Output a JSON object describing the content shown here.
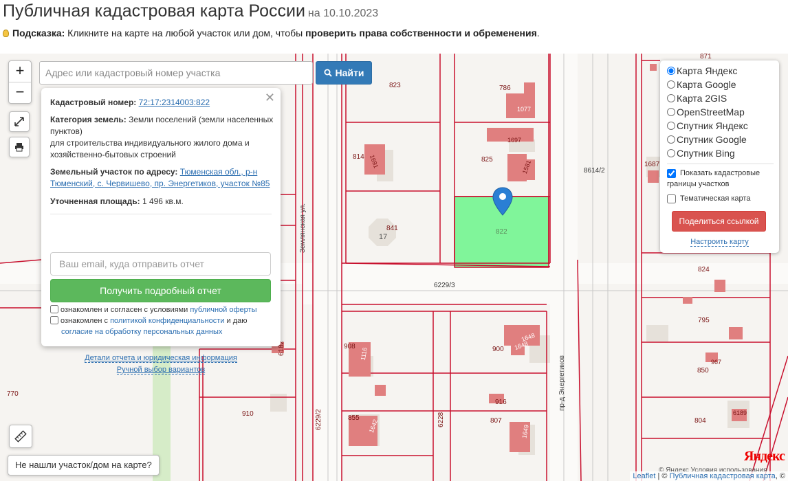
{
  "page": {
    "title": "Публичная кадастровая карта России",
    "date": "на 10.10.2023",
    "hint_label": "Подсказка:",
    "hint_text": " Кликните на карте на любой участок или дом, чтобы ",
    "hint_bold": "проверить права собственности и обременения",
    "hint_end": "."
  },
  "map": {
    "zoom_in": "+",
    "zoom_out": "−",
    "search_placeholder": "Адрес или кадастровый номер участка",
    "search_button": "Найти",
    "not_found": "Не нашли участок/дом на карте?",
    "plot_labels": [
      "871",
      "823",
      "786",
      "814",
      "825",
      "8614/2",
      "1687",
      "841",
      "17",
      "822",
      "824",
      "6229/3",
      "795",
      "908",
      "900",
      "967",
      "850",
      "770",
      "910",
      "855",
      "916",
      "807",
      "804",
      "6189"
    ],
    "building_labels": [
      "1077",
      "1697",
      "1691",
      "1581",
      "1116",
      "1648",
      "1648",
      "1642",
      "1649"
    ],
    "streets": {
      "zemlyanskaya": "Землянская ул.",
      "energetikov": "пр-д Энергетиков",
      "s6229_2": "6229/2",
      "s6228": "6228",
      "s6182": "6182",
      "s8614": "8614/2"
    }
  },
  "popup": {
    "cad_label": "Кадастровый номер:",
    "cad_value": "72:17:2314003:822",
    "category_label": "Категория земель:",
    "category_value": "Земли поселений (земли населенных пунктов)",
    "category_use": "для строительства индивидуального жилого дома и хозяйственно-бытовых строений",
    "address_label": "Земельный участок по адресу:",
    "address_value": "Тюменская обл., р-н Тюменский, с. Червишево, пр. Энергетиков, участок №85",
    "area_label": "Уточненная площадь:",
    "area_value": "1 496 кв.м.",
    "email_placeholder": "Ваш email, куда отправить отчет",
    "report_button": "Получить подробный отчет",
    "consent1_text": "ознакомлен и согласен с условиями ",
    "consent1_link": "публичной оферты",
    "consent2_text": "ознакомлен с ",
    "consent2_link": "политикой конфиденциальности",
    "consent2_mid": " и даю ",
    "consent2_link2": "согласие на обработку персональных данных",
    "details_link": "Детали отчета и юридическая информация",
    "manual_link": "Ручной выбор вариантов"
  },
  "layers": {
    "options": [
      "Карта Яндекс",
      "Карта Google",
      "Карта 2GIS",
      "OpenStreetMap",
      "Спутник Яндекс",
      "Спутник Google",
      "Спутник Bing"
    ],
    "selected": "Карта Яндекс",
    "show_borders": "Показать кадастровые границы участков",
    "show_borders_checked": true,
    "thematic": "Тематическая карта",
    "thematic_checked": false,
    "share_button": "Поделиться ссылкой",
    "setup_link": "Настроить карту"
  },
  "attribution": {
    "leaflet": "Leaflet",
    "sep": " | © ",
    "source": "Публичная кадастровая карта",
    "tail": ", ©",
    "yandex_logo": "Яндекс",
    "yandex_terms": "© Яндекс  Условия использования"
  },
  "colors": {
    "selected_plot": "#80f59a",
    "border": "#c8102e",
    "building": "#e07f7f",
    "search_button": "#337ab7",
    "report_button": "#5cb85c",
    "share_button": "#d9534f"
  }
}
